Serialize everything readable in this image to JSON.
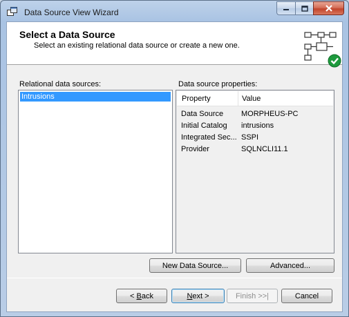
{
  "window": {
    "title": "Data Source View Wizard"
  },
  "header": {
    "title": "Select a Data Source",
    "subtitle": "Select an existing relational data source or create a new one."
  },
  "left_panel": {
    "label": "Relational data sources:",
    "items": [
      "Intrusions"
    ],
    "selected_item": "Intrusions"
  },
  "right_panel": {
    "label": "Data source properties:",
    "columns": [
      "Property",
      "Value"
    ],
    "rows": [
      {
        "property": "Data Source",
        "value": "MORPHEUS-PC"
      },
      {
        "property": "Initial Catalog",
        "value": "intrusions"
      },
      {
        "property": "Integrated Sec...",
        "value": "SSPI"
      },
      {
        "property": "Provider",
        "value": "SQLNCLI11.1"
      }
    ]
  },
  "buttons": {
    "new_data_source": "New Data Source...",
    "advanced": "Advanced...",
    "back": "Back",
    "back_prefix": "< ",
    "back_accel": "B",
    "back_rest": "ack",
    "next": "Next >",
    "next_accel": "N",
    "next_rest": "ext >",
    "finish": "Finish >>|",
    "cancel": "Cancel"
  },
  "colors": {
    "selection": "#3399ff",
    "close_button": "#c2452c",
    "success_check": "#1d9a3d"
  },
  "icons": {
    "app": "window-icon",
    "header": "data-source-view-icon",
    "check": "check-badge-icon"
  }
}
